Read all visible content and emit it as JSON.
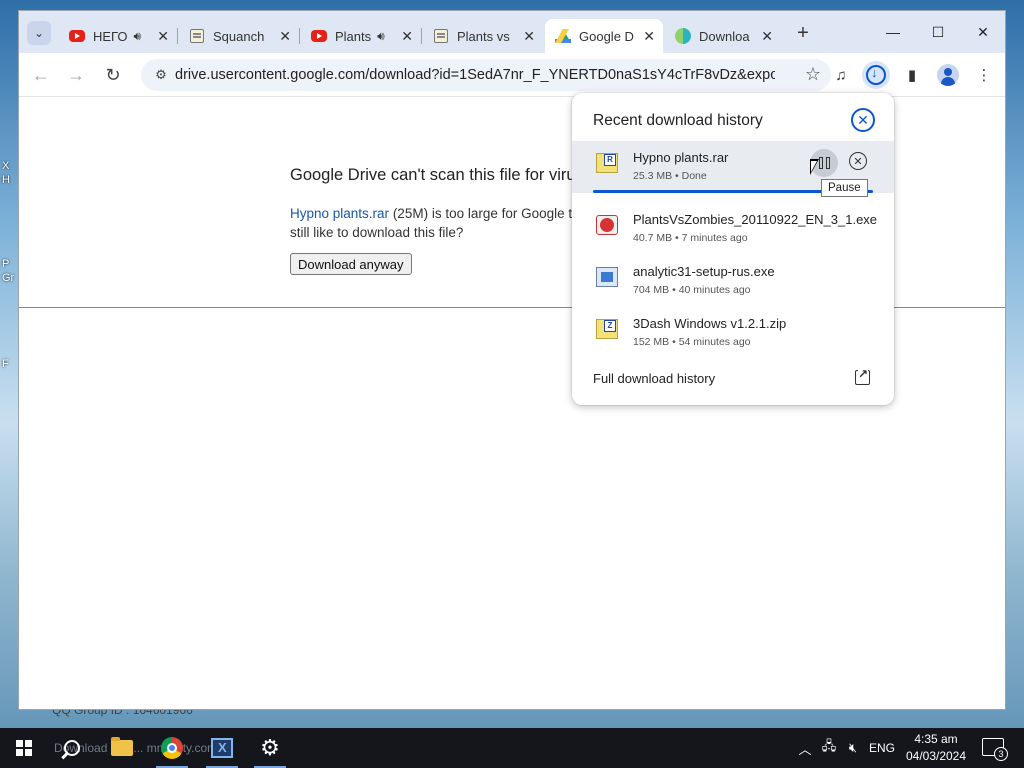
{
  "desktop": {
    "left_glyphs": [
      "X",
      "H",
      "P",
      "Gr",
      "F"
    ]
  },
  "tabs": [
    {
      "title": "НЕГО",
      "favicon": "youtube-icon",
      "audio": true,
      "active": false
    },
    {
      "title": "Squanch",
      "favicon": "page-icon",
      "audio": false,
      "active": false
    },
    {
      "title": "Plants",
      "favicon": "youtube-icon",
      "audio": true,
      "active": false
    },
    {
      "title": "Plants vs",
      "favicon": "page-icon",
      "audio": false,
      "active": false
    },
    {
      "title": "Google D",
      "favicon": "google-drive-icon",
      "audio": false,
      "active": true
    },
    {
      "title": "Downloa",
      "favicon": "download-site-icon",
      "audio": false,
      "active": false
    }
  ],
  "toolbar": {
    "url": "drive.usercontent.google.com/download?id=1SedA7nr_F_YNERTD0naS1sY4cTrF8vDz&export=d..."
  },
  "page": {
    "title": "Google Drive can't scan this file for virus",
    "file_link": "Hypno plants.rar",
    "body_text": " (25M) is too large for Google to",
    "body_text_2": "still like to download this file?",
    "button": "Download anyway"
  },
  "downloads": {
    "header": "Recent download history",
    "items": [
      {
        "name": "Hypno plants.rar",
        "meta": "25.3 MB • Done",
        "icon": "rar-file-icon"
      },
      {
        "name": "PlantsVsZombies_20110922_EN_3_1.exe",
        "meta": "40.7 MB • 7 minutes ago",
        "icon": "exe-file-icon"
      },
      {
        "name": "analytic31-setup-rus.exe",
        "meta": "704 MB • 40 minutes ago",
        "icon": "setup-file-icon"
      },
      {
        "name": "3Dash Windows v1.2.1.zip",
        "meta": "152 MB • 54 minutes ago",
        "icon": "zip-file-icon"
      }
    ],
    "progress": 1.0,
    "tooltip": "Pause",
    "full_history": "Full download history"
  },
  "behind_window_text": "QQ Group ID : 164601966",
  "taskbar": {
    "ghost_text": "Download ... /s... mmunity.com/",
    "lang": "ENG",
    "time": "4:35 am",
    "date": "04/03/2024",
    "notifications": "3"
  },
  "colors": {
    "accent": "#0b57d0",
    "tab_strip": "#dfe7f5",
    "link": "#1a57a8"
  }
}
